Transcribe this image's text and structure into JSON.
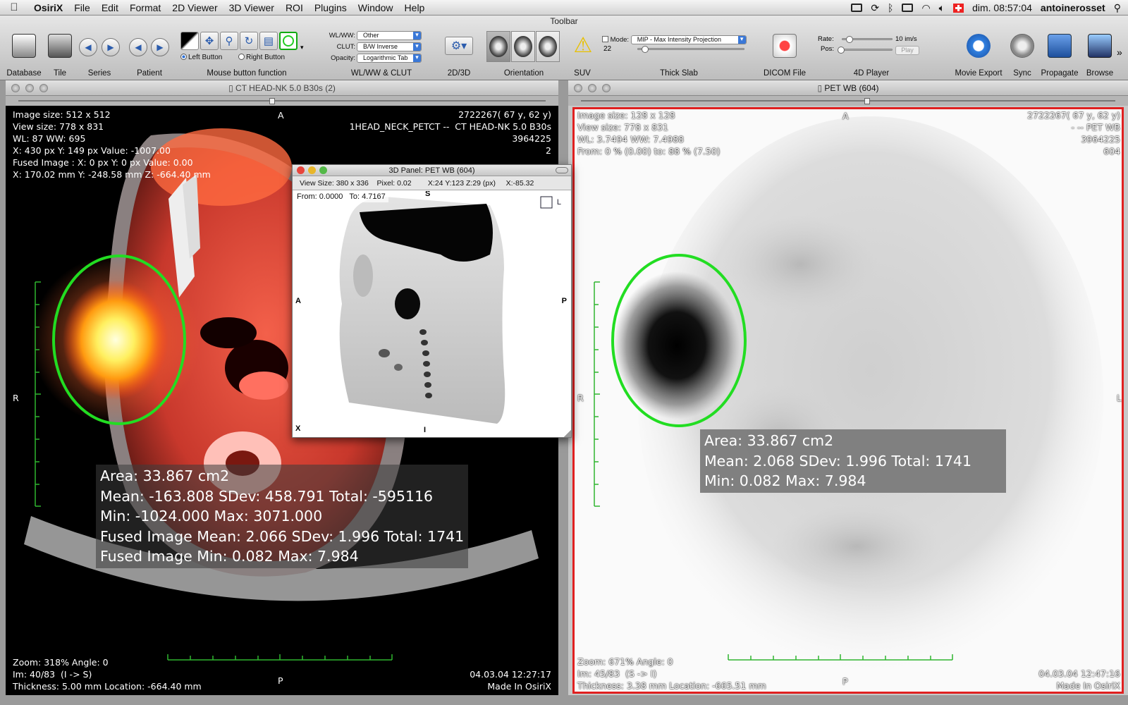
{
  "menubar": {
    "app": "OsiriX",
    "items": [
      "File",
      "Edit",
      "Format",
      "2D Viewer",
      "3D Viewer",
      "ROI",
      "Plugins",
      "Window",
      "Help"
    ],
    "clock": "dim. 08:57:04",
    "user": "antoinerosset"
  },
  "toolbar": {
    "title": "Toolbar",
    "groups": {
      "database": "Database",
      "tile": "Tile",
      "series": "Series",
      "patient": "Patient",
      "mouse": "Mouse button function",
      "wlww_clut": "WL/WW & CLUT",
      "view2d3d": "2D/3D",
      "orientation": "Orientation",
      "suv": "SUV",
      "thick_slab": "Thick Slab",
      "dicom_file": "DICOM File",
      "player4d": "4D Player",
      "movie_export": "Movie Export",
      "sync": "Sync",
      "propagate": "Propagate",
      "browse": "Browse"
    },
    "left_button": "Left Button",
    "right_button": "Right Button",
    "wlww_label": "WL/WW:",
    "wlww_value": "Other",
    "clut_label": "CLUT:",
    "clut_value": "B/W Inverse",
    "opacity_label": "Opacity:",
    "opacity_value": "Logarithmic Tab",
    "mode_label": "Mode:",
    "mode_value": "MIP - Max Intensity Projection",
    "slab_count": "22",
    "rate_label": "Rate:",
    "rate_value": "10 im/s",
    "pos_label": "Pos:",
    "play": "Play"
  },
  "ct_viewer": {
    "title": "CT HEAD-NK 5.0 B30s (2)",
    "tl": "Image size: 512 x 512\nView size: 778 x 831\nWL: 87 WW: 695\nX: 430 px Y: 149 px Value: -1007.00\nFused Image : X: 0 px Y: 0 px Value: 0.00\nX: 170.02 mm Y: -248.58 mm Z: -664.40 mm",
    "tr": "2722267( 67 y, 62 y)\n1HEAD_NECK_PETCT --  CT HEAD-NK 5.0 B30s\n3964225\n2",
    "bl": "Zoom: 318% Angle: 0\nIm: 40/83  (I -> S)\nThickness: 5.00 mm Location: -664.40 mm",
    "br": "04.03.04 12:27:17\nMade In OsiriX",
    "top_marker": "A",
    "bottom_marker": "P",
    "left_marker": "R",
    "roi_stats": "Area: 33.867 cm2\nMean: -163.808 SDev: 458.791 Total: -595116\nMin: -1024.000 Max: 3071.000\nFused Image Mean: 2.066 SDev: 1.996 Total: 1741\nFused Image Min: 0.082 Max: 7.984"
  },
  "pet_viewer": {
    "title": "PET WB (604)",
    "tl": "Image size: 128 x 128\nView size: 778 x 831\nWL: 3.7494 WW: 7.4988\nFrom: 0 % (0.00) to: 88 % (7.50)",
    "tr": "2722267( 67 y, 62 y)\n- -- PET WB\n3964225\n604",
    "bl": "Zoom: 671% Angle: 0\nIm: 45/83  (S -> I)\nThickness: 3.38 mm Location: -665.51 mm",
    "br": "04.03.04 12:47:16\nMade In OsiriX",
    "top_marker": "A",
    "bottom_marker": "P",
    "left_marker": "R",
    "right_marker": "L",
    "roi_stats": "Area: 33.867 cm2\nMean: 2.068 SDev: 1.996 Total: 1741\nMin: 0.082 Max: 7.984"
  },
  "panel3d": {
    "title": "3D Panel: PET WB (604)",
    "info": "View Size: 380 x 336    Pixel: 0.02        X:24 Y:123 Z:29 (px)     X:-85.32",
    "from_to": "From: 0.0000   To: 4.7167",
    "top": "S",
    "bottom": "I",
    "left": "A",
    "right": "P",
    "corner": "X",
    "cube": "L"
  },
  "colors": {
    "roi": "#22dd22",
    "key_window": "#e02020",
    "ruler": "#2fb52f"
  }
}
